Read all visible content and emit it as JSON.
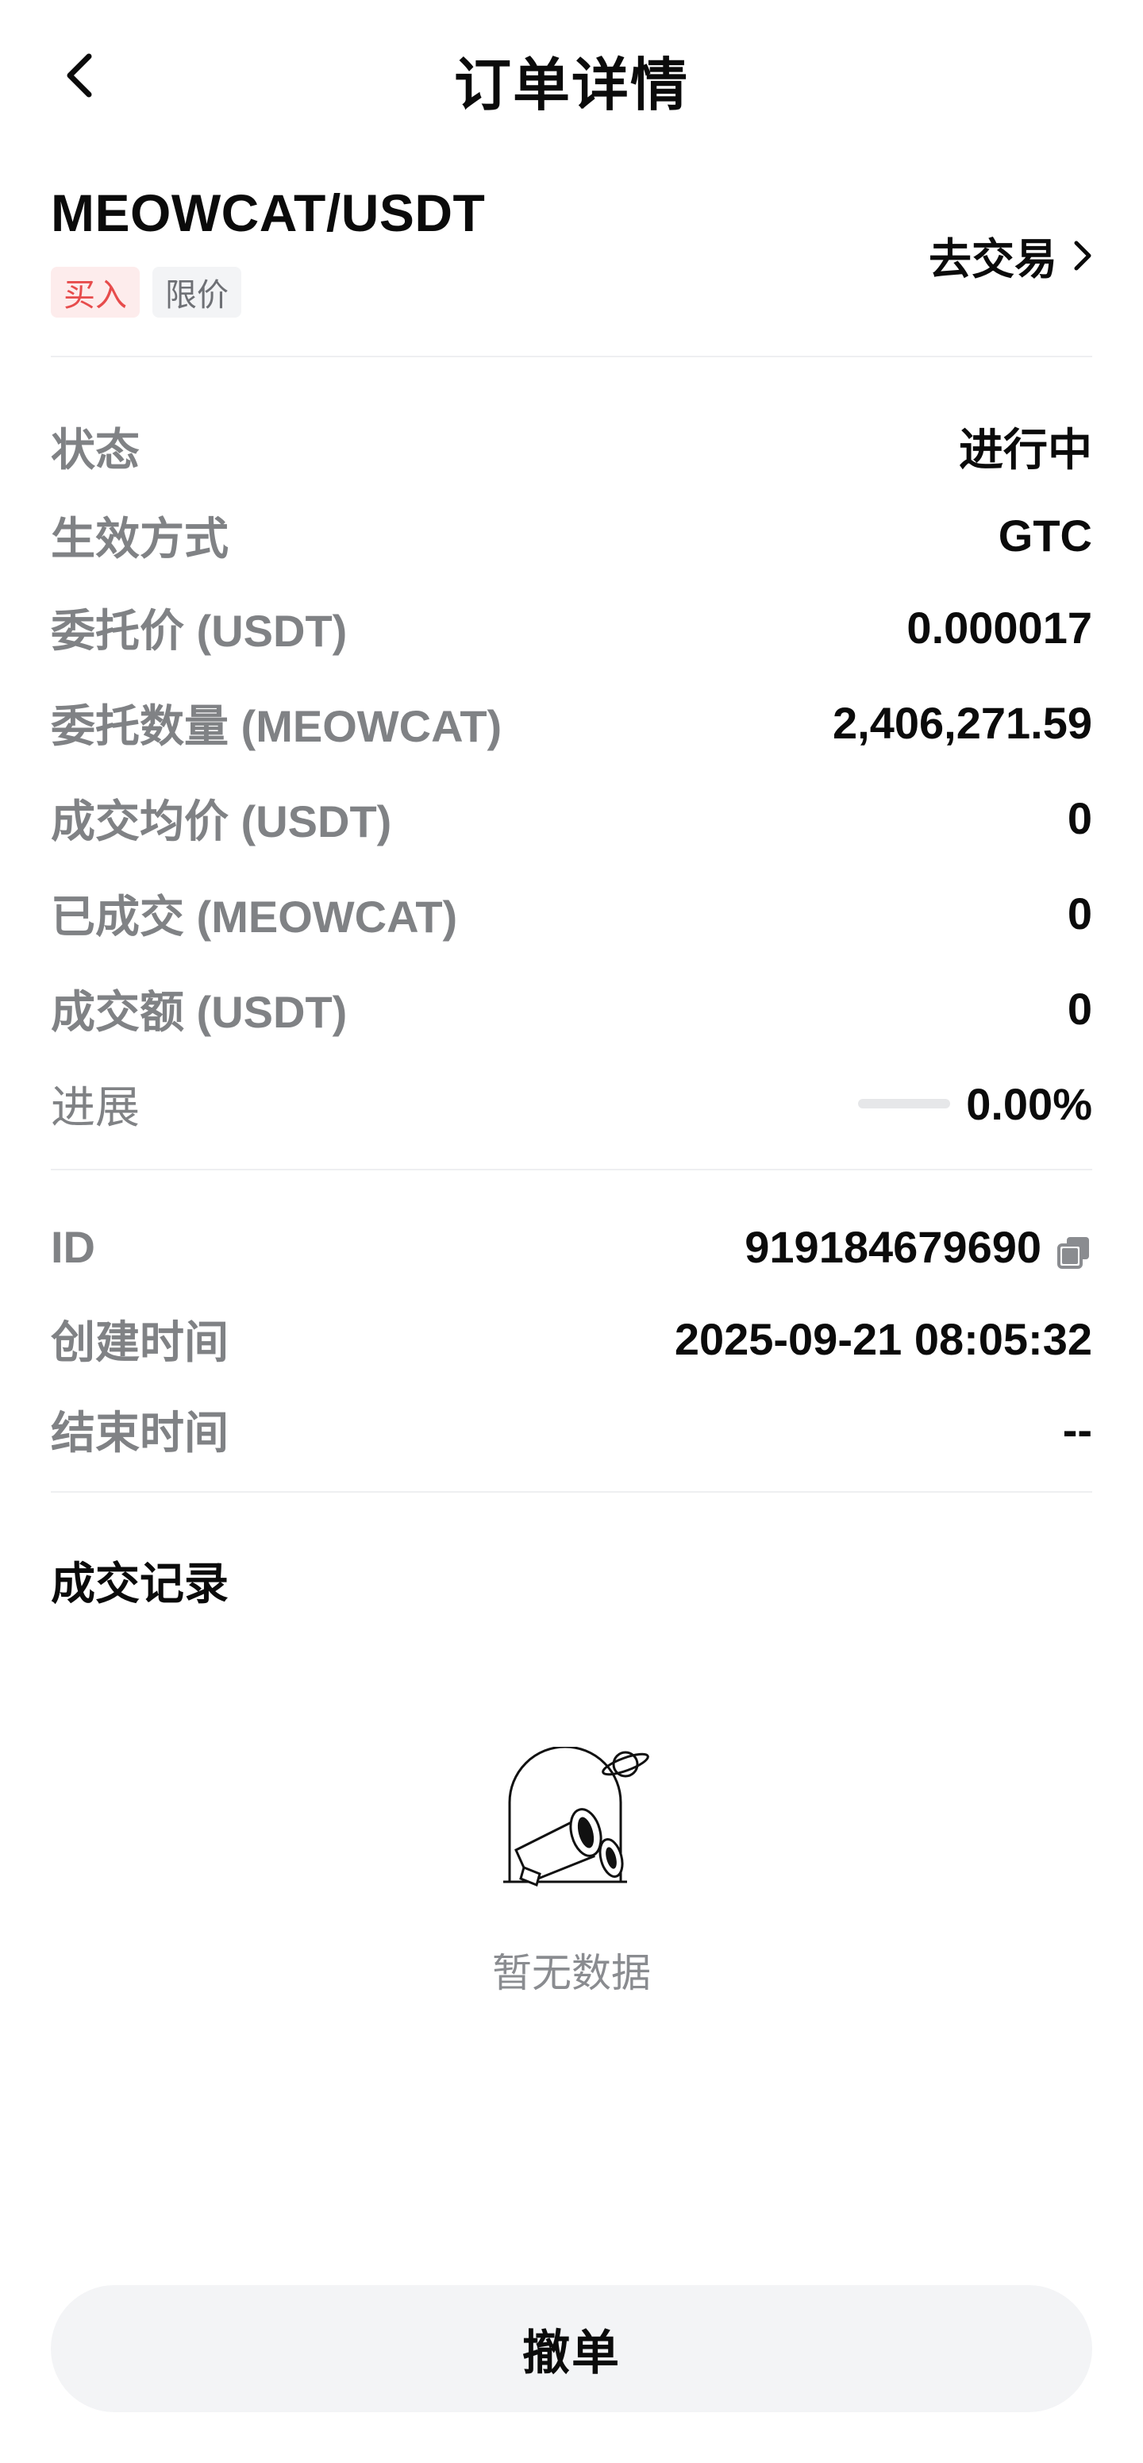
{
  "header": {
    "title": "订单详情",
    "back_icon": "chevron-left-icon"
  },
  "pair": {
    "name": "MEOWCAT/USDT",
    "side_tag": "买入",
    "type_tag": "限价",
    "trade_link": "去交易",
    "trade_icon": "chevron-right-icon"
  },
  "details": [
    {
      "label": "状态",
      "value": "进行中"
    },
    {
      "label": "生效方式",
      "value": "GTC"
    },
    {
      "label": "委托价 (USDT)",
      "value": "0.000017"
    },
    {
      "label": "委托数量 (MEOWCAT)",
      "value": "2,406,271.59"
    },
    {
      "label": "成交均价 (USDT)",
      "value": "0"
    },
    {
      "label": "已成交 (MEOWCAT)",
      "value": "0"
    },
    {
      "label": "成交额 (USDT)",
      "value": "0"
    },
    {
      "label": "进展",
      "value": "0.00%",
      "progress": 0.0
    }
  ],
  "meta": [
    {
      "label": "ID",
      "value": "919184679690",
      "icon": "copy-icon"
    },
    {
      "label": "创建时间",
      "value": "2025-09-21 08:05:32"
    },
    {
      "label": "结束时间",
      "value": "--"
    }
  ],
  "records": {
    "title": "成交记录",
    "empty_text": "暂无数据",
    "empty_icon": "binoculars-planet-icon"
  },
  "footer": {
    "cancel_label": "撤单"
  },
  "colors": {
    "buy_red": "#e74c4c",
    "accent_green": "#2fbd85",
    "muted": "#808285"
  }
}
